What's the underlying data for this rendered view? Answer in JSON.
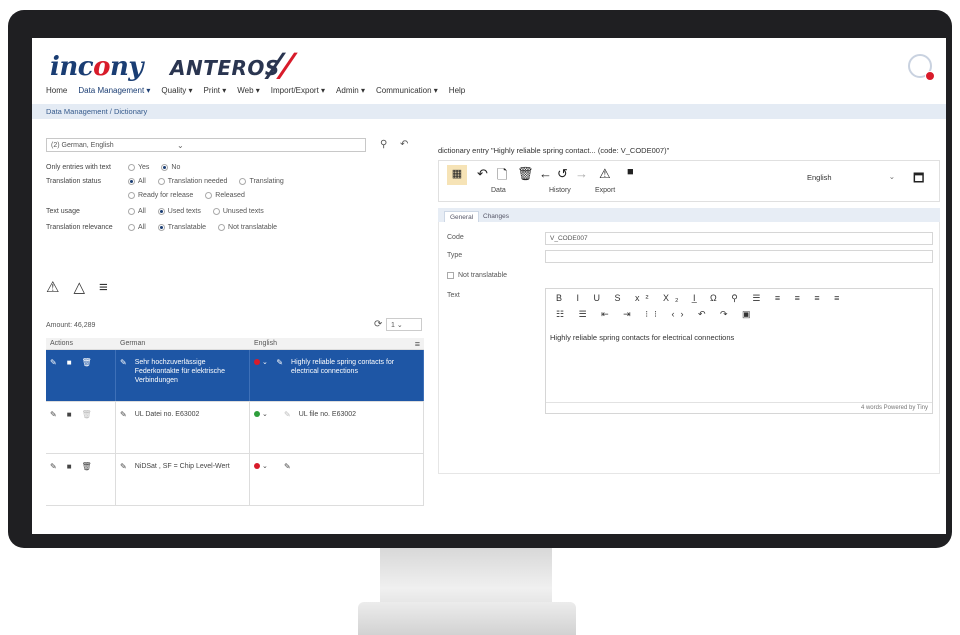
{
  "logo": {
    "brand": "incony",
    "product": "ANTEROS"
  },
  "nav": [
    "Home",
    "Data Management ▾",
    "Quality ▾",
    "Print ▾",
    "Web ▾",
    "Import/Export ▾",
    "Admin ▾",
    "Communication ▾",
    "Help"
  ],
  "breadcrumb": "Data Management / Dictionary",
  "filters": {
    "language": "(2) German, English",
    "rows": [
      {
        "label": "Only entries with text",
        "options": [
          "Yes",
          "No"
        ],
        "selected": 1
      },
      {
        "label": "Translation status",
        "options": [
          "All",
          "Translation needed",
          "Translating"
        ],
        "selected": 0
      },
      {
        "label": "",
        "options": [
          "Ready for release",
          "Released"
        ],
        "selected": -1
      },
      {
        "label": "Text usage",
        "options": [
          "All",
          "Used texts",
          "Unused texts"
        ],
        "selected": 1
      },
      {
        "label": "Translation relevance",
        "options": [
          "All",
          "Translatable",
          "Not translatable"
        ],
        "selected": 1
      }
    ]
  },
  "list": {
    "amount": "Amount: 46,289",
    "page": "1",
    "columns": [
      "Actions",
      "German",
      "English"
    ],
    "rows": [
      {
        "german": "Sehr hochzuverlässige Federkontakte für elektrische Verbindungen",
        "english": "Highly reliable spring contacts for electrical connections",
        "status_color": "#d81b2a",
        "selected": true
      },
      {
        "german": "UL Datei no. E63002",
        "english": "UL file no. E63002",
        "status_color": "#2e9e3b",
        "selected": false
      },
      {
        "german": "NiDSat , SF = Chip Level-Wert",
        "english": "",
        "status_color": "#d81b2a",
        "selected": false
      }
    ]
  },
  "entry": {
    "title": "dictionary entry \"Highly reliable spring contact... (code: V_CODE007)\"",
    "toolbar_labels": [
      "Data",
      "History",
      "Export"
    ],
    "language": "English",
    "tabs": [
      "General",
      "Changes"
    ],
    "code_label": "Code",
    "code_value": "V_CODE007",
    "type_label": "Type",
    "not_translatable": "Not translatable",
    "text_label": "Text",
    "text_value": "Highly reliable spring contacts for electrical connections",
    "footer": "4 words  Powered by Tiny"
  },
  "colors": {
    "primary": "#1e56a5",
    "brand_red": "#d81b2a",
    "navy": "#1a3d73"
  }
}
